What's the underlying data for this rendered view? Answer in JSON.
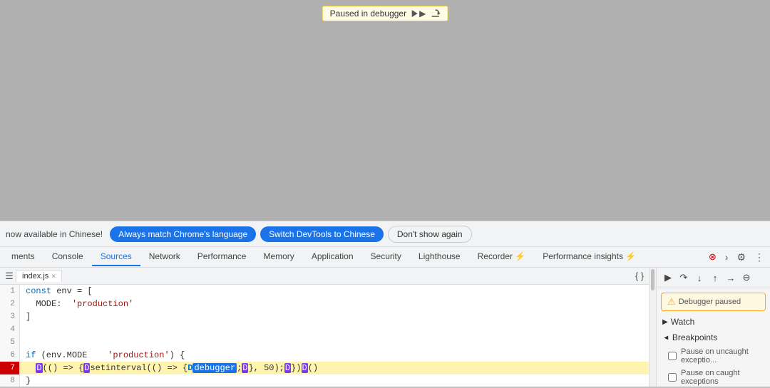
{
  "viewport": {
    "background": "#b0b0b0"
  },
  "debugger_banner": {
    "text": "Paused in debugger",
    "resume_title": "Resume script execution",
    "step_over_title": "Step over"
  },
  "language_bar": {
    "prompt_text": "now available in Chinese!",
    "btn_always_label": "Always match Chrome's language",
    "btn_switch_label": "Switch DevTools to Chinese",
    "btn_dismiss_label": "Don't show again"
  },
  "devtools_tabs": [
    {
      "label": "ments",
      "active": false
    },
    {
      "label": "Console",
      "active": false
    },
    {
      "label": "Sources",
      "active": true
    },
    {
      "label": "Network",
      "active": false
    },
    {
      "label": "Performance",
      "active": false
    },
    {
      "label": "Memory",
      "active": false
    },
    {
      "label": "Application",
      "active": false
    },
    {
      "label": "Security",
      "active": false
    },
    {
      "label": "Lighthouse",
      "active": false
    },
    {
      "label": "Recorder ⚡",
      "active": false
    },
    {
      "label": "Performance insights ⚡",
      "active": false
    }
  ],
  "file_tab": {
    "name": "index.js",
    "close_icon": "×"
  },
  "code_lines": [
    {
      "num": "1",
      "content": "const env = [",
      "highlight": false,
      "breakpoint": false
    },
    {
      "num": "2",
      "content": "  MODE:  'production'",
      "highlight": false,
      "breakpoint": false
    },
    {
      "num": "3",
      "content": "]",
      "highlight": false,
      "breakpoint": false
    },
    {
      "num": "4",
      "content": "",
      "highlight": false,
      "breakpoint": false
    },
    {
      "num": "5",
      "content": "",
      "highlight": false,
      "breakpoint": false
    },
    {
      "num": "6",
      "content": "if (env.MODE    'production') {",
      "highlight": false,
      "breakpoint": false
    },
    {
      "num": "7",
      "content": "  D(() => {Dsetinterval(() => {Ddebugger;D}, 50);D})D()",
      "highlight": true,
      "breakpoint": true
    },
    {
      "num": "8",
      "content": "}",
      "highlight": false,
      "breakpoint": false
    }
  ],
  "right_panel": {
    "debugger_paused": "Debugger paused",
    "watch_label": "Watch",
    "breakpoints_label": "Breakpoints",
    "pause_uncaught": "Pause on uncaught exceptio...",
    "pause_caught": "Pause on caught exceptions"
  }
}
